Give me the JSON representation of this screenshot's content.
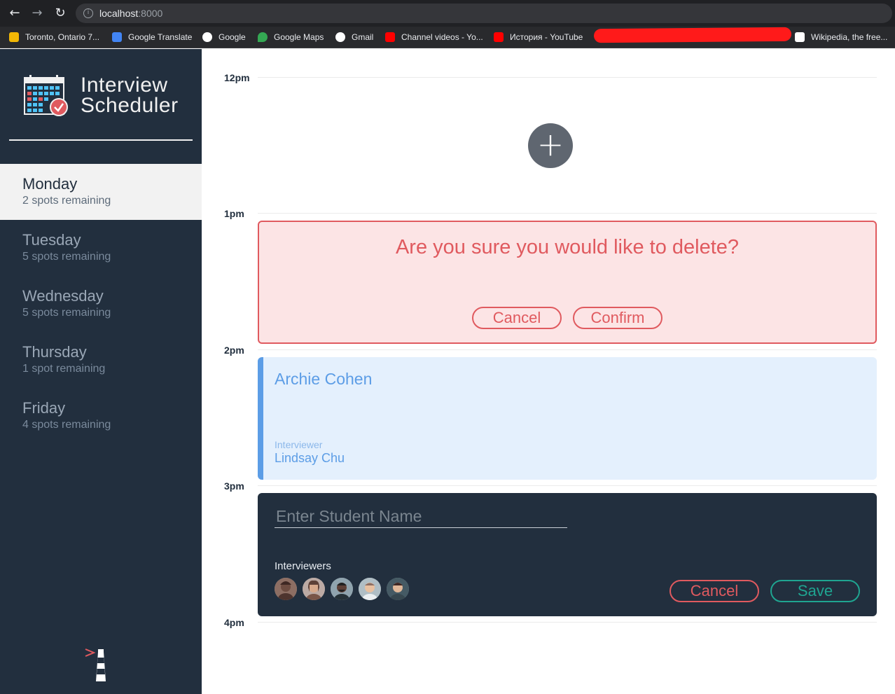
{
  "browser": {
    "url_host": "localhost",
    "url_port": ":8000",
    "bookmarks": [
      {
        "label": "Toronto, Ontario 7...",
        "icon": "weather-icon",
        "color": "#f2b705"
      },
      {
        "label": "Google Translate",
        "icon": "translate-icon",
        "color": "#4285f4"
      },
      {
        "label": "Google",
        "icon": "google-icon",
        "color": "#ffffff"
      },
      {
        "label": "Google Maps",
        "icon": "maps-pin-icon",
        "color": "#34a853"
      },
      {
        "label": "Gmail",
        "icon": "google-icon",
        "color": "#ffffff"
      },
      {
        "label": "Channel videos - Yo...",
        "icon": "youtube-icon",
        "color": "#ff0000"
      },
      {
        "label": "История - YouTube",
        "icon": "youtube-icon",
        "color": "#ff0000"
      },
      {
        "label": "Wikipedia, the free...",
        "icon": "wikipedia-icon",
        "color": "#ffffff"
      }
    ]
  },
  "sidebar": {
    "app_title_line1": "Interview",
    "app_title_line2": "Scheduler",
    "days": [
      {
        "name": "Monday",
        "spots": "2 spots remaining",
        "selected": true
      },
      {
        "name": "Tuesday",
        "spots": "5 spots remaining",
        "selected": false
      },
      {
        "name": "Wednesday",
        "spots": "5 spots remaining",
        "selected": false
      },
      {
        "name": "Thursday",
        "spots": "1 spot remaining",
        "selected": false
      },
      {
        "name": "Friday",
        "spots": "4 spots remaining",
        "selected": false
      }
    ]
  },
  "schedule": {
    "times": [
      "12pm",
      "1pm",
      "2pm",
      "3pm",
      "4pm"
    ],
    "confirm": {
      "message": "Are you sure you would like to delete?",
      "cancel_label": "Cancel",
      "confirm_label": "Confirm"
    },
    "appointment": {
      "student": "Archie Cohen",
      "interviewer_label": "Interviewer",
      "interviewer_name": "Lindsay Chu"
    },
    "form": {
      "student_placeholder": "Enter Student Name",
      "interviewers_label": "Interviewers",
      "cancel_label": "Cancel",
      "save_label": "Save"
    }
  },
  "colors": {
    "sidebar_bg": "#222f3e",
    "danger": "#e05a5f",
    "success": "#1fa591",
    "appointment_accent": "#5c9de6"
  }
}
